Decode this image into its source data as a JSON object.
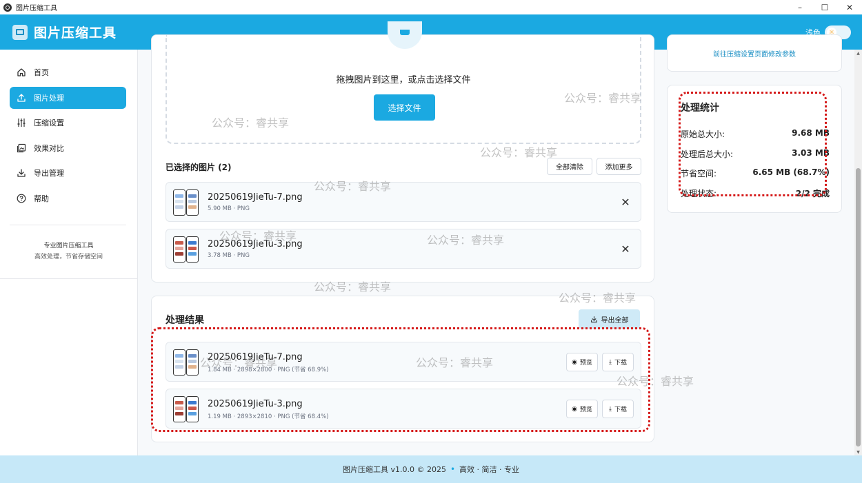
{
  "window": {
    "title": "图片压缩工具",
    "controls": [
      "–",
      "☐",
      "✕"
    ]
  },
  "header": {
    "title": "图片压缩工具",
    "theme_label": "浅色"
  },
  "sidebar": {
    "items": [
      {
        "label": "首页",
        "icon": "home-icon"
      },
      {
        "label": "图片处理",
        "icon": "upload-icon",
        "active": true
      },
      {
        "label": "压缩设置",
        "icon": "sliders-icon"
      },
      {
        "label": "效果对比",
        "icon": "image-compare-icon"
      },
      {
        "label": "导出管理",
        "icon": "download-icon"
      },
      {
        "label": "帮助",
        "icon": "help-icon"
      }
    ],
    "footer_title": "专业图片压缩工具",
    "footer_subtitle": "高效处理，节省存储空间"
  },
  "upload": {
    "drop_text": "拖拽图片到这里，或点击选择文件",
    "select_button": "选择文件",
    "selected_title": "已选择的图片 (2)",
    "clear_all": "全部清除",
    "add_more": "添加更多",
    "files": [
      {
        "name": "20250619JieTu-7.png",
        "meta": "5.90 MB · PNG"
      },
      {
        "name": "20250619JieTu-3.png",
        "meta": "3.78 MB · PNG"
      }
    ]
  },
  "results": {
    "title": "处理结果",
    "export_all": "导出全部",
    "preview_label": "预览",
    "download_label": "下载",
    "files": [
      {
        "name": "20250619JieTu-7.png",
        "meta": "1.84 MB · 2898×2800 · PNG (节省 68.9%)"
      },
      {
        "name": "20250619JieTu-3.png",
        "meta": "1.19 MB · 2893×2810 · PNG (节省 68.4%)"
      }
    ]
  },
  "tip": {
    "link_text": "前往压缩设置页面修改参数"
  },
  "stats": {
    "title": "处理统计",
    "rows": [
      {
        "label": "原始总大小:",
        "value": "9.68 MB"
      },
      {
        "label": "处理后总大小:",
        "value": "3.03 MB"
      },
      {
        "label": "节省空间:",
        "value": "6.65 MB (68.7%)"
      },
      {
        "label": "处理状态:",
        "value": "2/2 完成"
      }
    ]
  },
  "footer": {
    "version": "图片压缩工具 v1.0.0 © 2025",
    "separator": "•",
    "tagline": "高效 · 简洁 · 专业"
  },
  "watermark": "公众号：睿共享",
  "colors": {
    "accent": "#1ba9e1",
    "highlight": "#d51a1a",
    "footer_bg": "#c6e8f8"
  }
}
